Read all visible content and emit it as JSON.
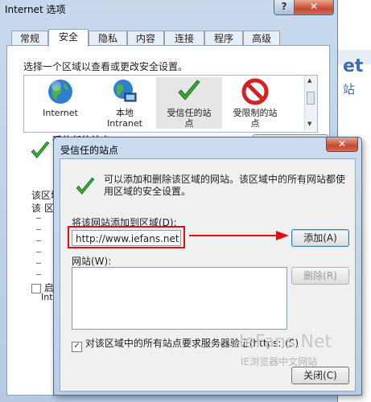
{
  "background": {
    "heading": "et",
    "subtext": "站"
  },
  "window": {
    "title": "Internet 选项",
    "help": "?",
    "close": "✕"
  },
  "tabs": [
    {
      "label": "常规"
    },
    {
      "label": "安全"
    },
    {
      "label": "隐私"
    },
    {
      "label": "内容"
    },
    {
      "label": "连接"
    },
    {
      "label": "程序"
    },
    {
      "label": "高级"
    }
  ],
  "security": {
    "zone_prompt": "选择一个区域以查看或更改安全设置。",
    "zones": [
      {
        "label": "Internet",
        "icon": "globe-icon"
      },
      {
        "label": "本地\nIntranet",
        "icon": "intranet-globe-icon"
      },
      {
        "label": "受信任的站\n点",
        "icon": "checkmark-icon"
      },
      {
        "label": "受限制的站\n点",
        "icon": "no-entry-icon"
      }
    ],
    "selected_zone_title": "受信任的站点",
    "level_label_1": "该区域",
    "level_label_2": "该 区",
    "enable_label": "启用",
    "enable_sub": "Int"
  },
  "dialog": {
    "title": "受信任的站点",
    "close": "✕",
    "description": "可以添加和删除该区域的网站。该区域中的所有网站都使用区域的安全设置。",
    "add_label": "将该网站添加到区域(D):",
    "url_value": "http://www.iefans.net",
    "add_button": "添加(A)",
    "sites_label": "网站(W):",
    "sites": [],
    "remove_button": "删除(R)",
    "verify_label": "对该区域中的所有站点要求服务器验证(https:)(S)",
    "verify_checked": "✓",
    "close_button": "关闭(C)"
  },
  "watermark": {
    "brand": "IeFans.Net",
    "tagline": "IE浏览器中文网站"
  },
  "colors": {
    "highlight_red": "#e01010",
    "check_green": "#2e9a2e"
  }
}
